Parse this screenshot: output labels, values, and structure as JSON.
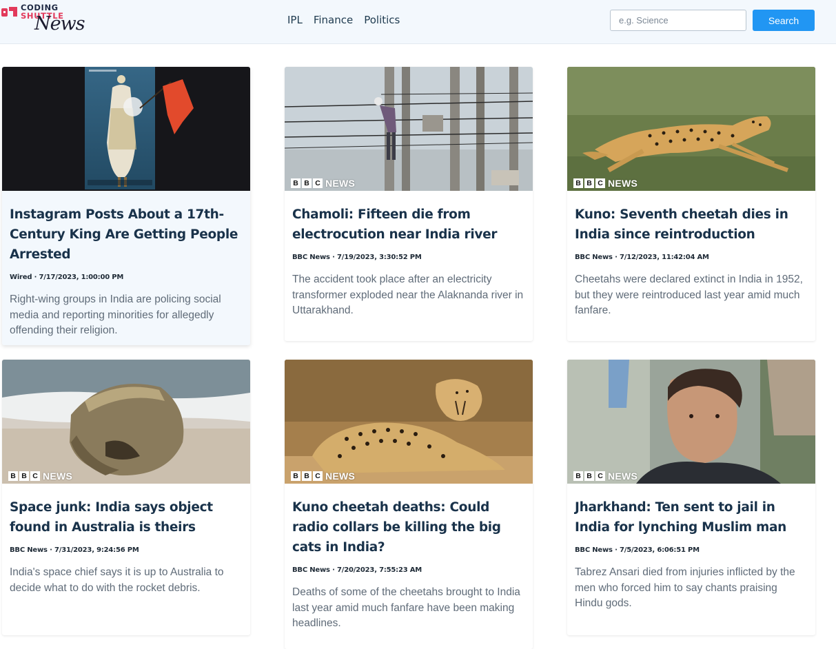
{
  "brand": {
    "line1": "CODING",
    "line2": "SHUTTLE",
    "script": "News"
  },
  "nav": {
    "links": [
      "IPL",
      "Finance",
      "Politics"
    ]
  },
  "search": {
    "placeholder": "e.g. Science",
    "value": "",
    "button_label": "Search"
  },
  "colors": {
    "accent": "#2196f3",
    "brand_red": "#e23a5b",
    "title": "#19324a",
    "navbar_bg": "#f3f8fd"
  },
  "articles": [
    {
      "title": "Instagram Posts About a 17th-Century King Are Getting People Arrested",
      "source": "Wired",
      "date": "7/17/2023, 1:00:00 PM",
      "description": "Right-wing groups in India are policing social media and reporting minorities for allegedly offending their religion.",
      "image_badge": ""
    },
    {
      "title": "Chamoli: Fifteen die from electrocution near India river",
      "source": "BBC News",
      "date": "7/19/2023, 3:30:52 PM",
      "description": "The accident took place after an electricity transformer exploded near the Alaknanda river in Uttarakhand.",
      "image_badge": "NEWS"
    },
    {
      "title": "Kuno: Seventh cheetah dies in India since reintroduction",
      "source": "BBC News",
      "date": "7/12/2023, 11:42:04 AM",
      "description": "Cheetahs were declared extinct in India in 1952, but they were reintroduced last year amid much fanfare.",
      "image_badge": "NEWS"
    },
    {
      "title": "Space junk: India says object found in Australia is theirs",
      "source": "BBC News",
      "date": "7/31/2023, 9:24:56 PM",
      "description": "India's space chief says it is up to Australia to decide what to do with the rocket debris.",
      "image_badge": "NEWS"
    },
    {
      "title": "Kuno cheetah deaths: Could radio collars be killing the big cats in India?",
      "source": "BBC News",
      "date": "7/20/2023, 7:55:23 AM",
      "description": "Deaths of some of the cheetahs brought to India last year amid much fanfare have been making headlines.",
      "image_badge": "NEWS"
    },
    {
      "title": "Jharkhand: Ten sent to jail in India for lynching Muslim man",
      "source": "BBC News",
      "date": "7/5/2023, 6:06:51 PM",
      "description": "Tabrez Ansari died from injuries inflicted by the men who forced him to say chants praising Hindu gods.",
      "image_badge": "NEWS"
    }
  ]
}
